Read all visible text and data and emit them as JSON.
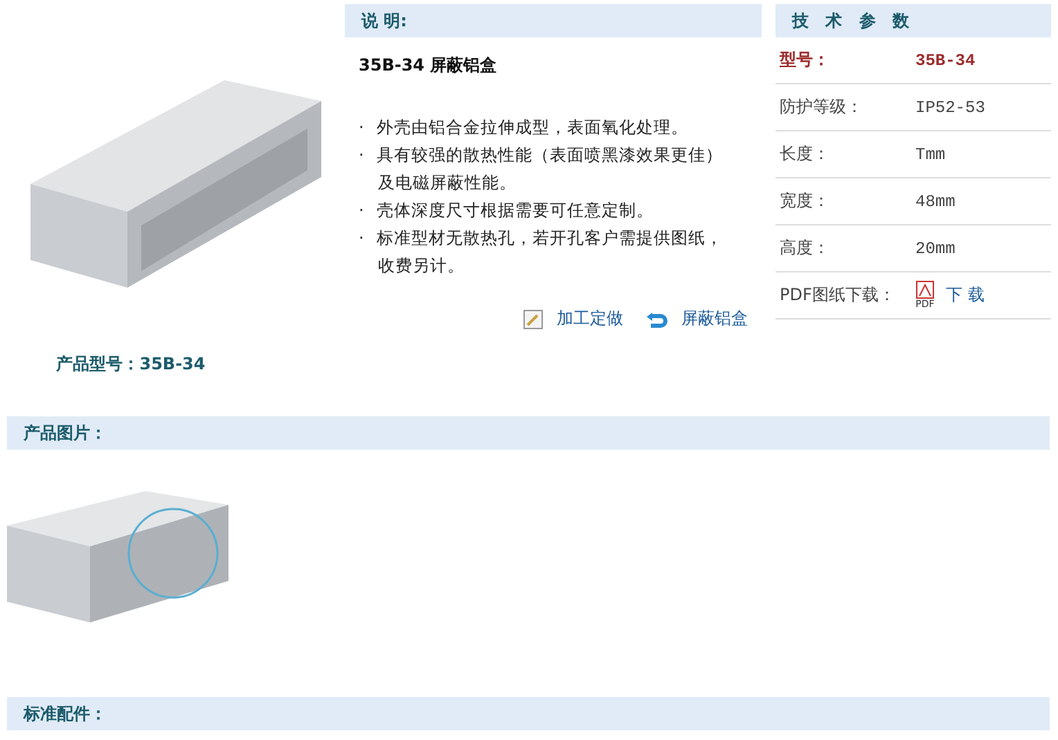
{
  "product": {
    "caption_label": "产品型号：",
    "caption_value": "35B-34"
  },
  "description": {
    "heading": "说 明:",
    "title": "35B-34 屏蔽铝盒",
    "lines": [
      {
        "kind": "bullet",
        "mark": "·",
        "text": "外壳由铝合金拉伸成型，表面氧化处理。"
      },
      {
        "kind": "bullet",
        "mark": "·",
        "text": "具有较强的散热性能（表面喷黑漆效果更佳）"
      },
      {
        "kind": "continuation",
        "text": "及电磁屏蔽性能。"
      },
      {
        "kind": "bullet",
        "mark": "·",
        "text": "壳体深度尺寸根据需要可任意定制。"
      },
      {
        "kind": "bullet",
        "mark": "·",
        "text": "标准型材无散热孔，若开孔客户需提供图纸，"
      },
      {
        "kind": "continuation",
        "text": "收费另计。"
      }
    ],
    "links": [
      {
        "kind": "custom",
        "label": "加工定做"
      },
      {
        "kind": "back",
        "label": "屏蔽铝盒"
      }
    ]
  },
  "specs": {
    "heading": "技 术 参 数",
    "rows": [
      {
        "kind": "highlight",
        "label": "型号：",
        "value": "35B-34"
      },
      {
        "kind": "plain",
        "label": "防护等级：",
        "value": "IP52-53"
      },
      {
        "kind": "plain",
        "label": "长度：",
        "value": "Tmm"
      },
      {
        "kind": "plain",
        "label": "宽度：",
        "value": "48mm"
      },
      {
        "kind": "plain",
        "label": "高度：",
        "value": "20mm"
      },
      {
        "kind": "download",
        "label": "PDF图纸下载：",
        "value": "下 载",
        "icon_label": "PDF"
      }
    ]
  },
  "sections": [
    {
      "kind": "gallery",
      "heading": "产品图片："
    },
    {
      "kind": "plain",
      "heading": "标准配件："
    }
  ]
}
